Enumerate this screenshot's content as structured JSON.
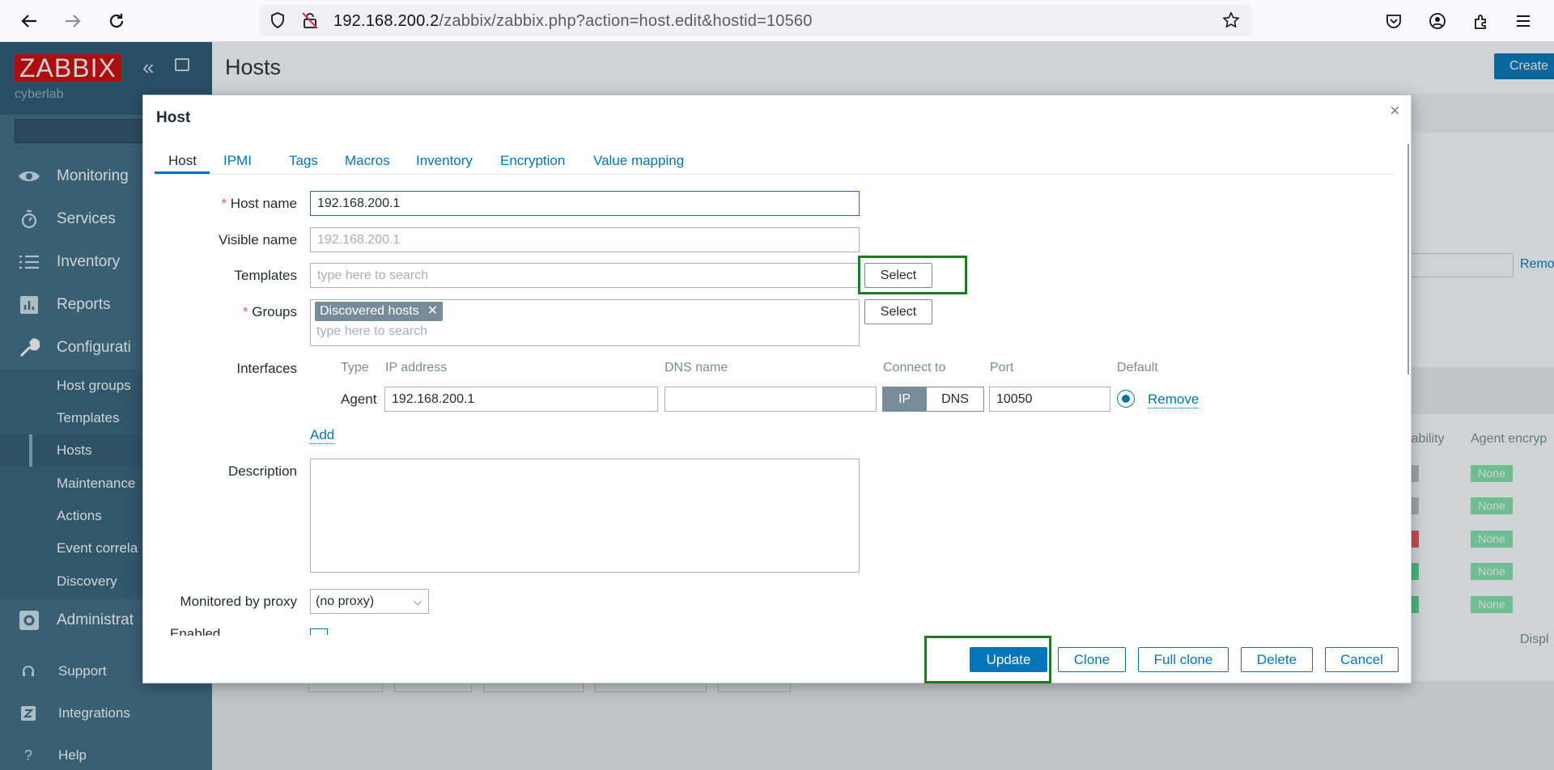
{
  "browser": {
    "url_host": "192.168.200.2",
    "url_path": "/zabbix/zabbix.php?action=host.edit&hostid=10560"
  },
  "sidebar": {
    "logo": "ZABBIX",
    "server_name": "cyberlab",
    "menu": [
      {
        "label": "Monitoring"
      },
      {
        "label": "Services"
      },
      {
        "label": "Inventory"
      },
      {
        "label": "Reports"
      },
      {
        "label": "Configurati"
      },
      {
        "label": "Administrat"
      }
    ],
    "submenu": [
      {
        "label": "Host groups"
      },
      {
        "label": "Templates"
      },
      {
        "label": "Hosts"
      },
      {
        "label": "Maintenance"
      },
      {
        "label": "Actions"
      },
      {
        "label": "Event correla"
      },
      {
        "label": "Discovery"
      }
    ],
    "footer": [
      {
        "label": "Support"
      },
      {
        "label": "Integrations"
      },
      {
        "label": "Help"
      }
    ]
  },
  "page": {
    "title": "Hosts",
    "create_label": "Create",
    "remove_link": "Remo",
    "col_availability": "lability",
    "col_encryption": "Agent encryp",
    "encryption_badges": [
      "None",
      "None",
      "None",
      "None",
      "None"
    ],
    "display_text": "Displ"
  },
  "modal": {
    "title": "Host",
    "close": "×",
    "tabs": [
      "Host",
      "IPMI",
      "Tags",
      "Macros",
      "Inventory",
      "Encryption",
      "Value mapping"
    ],
    "fields": {
      "host_name_label": "Host name",
      "host_name_value": "192.168.200.1",
      "visible_name_label": "Visible name",
      "visible_name_placeholder": "192.168.200.1",
      "templates_label": "Templates",
      "templates_placeholder": "type here to search",
      "select_label": "Select",
      "groups_label": "Groups",
      "group_chip": "Discovered hosts",
      "groups_placeholder": "type here to search",
      "interfaces_label": "Interfaces",
      "description_label": "Description",
      "proxy_label": "Monitored by proxy",
      "proxy_value": "(no proxy)",
      "enabled_label": "Enabled"
    },
    "interfaces": {
      "headers": [
        "Type",
        "IP address",
        "DNS name",
        "Connect to",
        "Port",
        "Default"
      ],
      "row": {
        "type": "Agent",
        "ip": "192.168.200.1",
        "dns": "",
        "connect_ip": "IP",
        "connect_dns": "DNS",
        "port": "10050",
        "remove": "Remove"
      },
      "add": "Add"
    },
    "buttons": {
      "update": "Update",
      "clone": "Clone",
      "full_clone": "Full clone",
      "delete": "Delete",
      "cancel": "Cancel"
    }
  }
}
